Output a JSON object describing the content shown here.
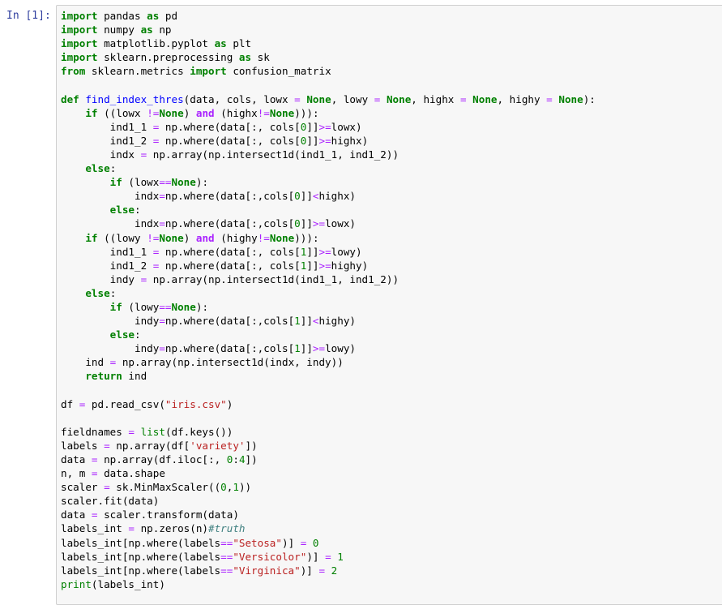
{
  "cell": {
    "prompt": "In [1]:",
    "lines": [
      [
        [
          "k",
          "import"
        ],
        [
          "t",
          " pandas "
        ],
        [
          "k",
          "as"
        ],
        [
          "t",
          " pd"
        ]
      ],
      [
        [
          "k",
          "import"
        ],
        [
          "t",
          " numpy "
        ],
        [
          "k",
          "as"
        ],
        [
          "t",
          " np"
        ]
      ],
      [
        [
          "k",
          "import"
        ],
        [
          "t",
          " matplotlib.pyplot "
        ],
        [
          "k",
          "as"
        ],
        [
          "t",
          " plt"
        ]
      ],
      [
        [
          "k",
          "import"
        ],
        [
          "t",
          " sklearn.preprocessing "
        ],
        [
          "k",
          "as"
        ],
        [
          "t",
          " sk"
        ]
      ],
      [
        [
          "k",
          "from"
        ],
        [
          "t",
          " sklearn.metrics "
        ],
        [
          "k",
          "import"
        ],
        [
          "t",
          " confusion_matrix"
        ]
      ],
      [],
      [
        [
          "k",
          "def"
        ],
        [
          "t",
          " "
        ],
        [
          "nf",
          "find_index_thres"
        ],
        [
          "t",
          "(data, cols, lowx "
        ],
        [
          "o",
          "="
        ],
        [
          "t",
          " "
        ],
        [
          "k",
          "None"
        ],
        [
          "t",
          ", lowy "
        ],
        [
          "o",
          "="
        ],
        [
          "t",
          " "
        ],
        [
          "k",
          "None"
        ],
        [
          "t",
          ", highx "
        ],
        [
          "o",
          "="
        ],
        [
          "t",
          " "
        ],
        [
          "k",
          "None"
        ],
        [
          "t",
          ", highy "
        ],
        [
          "o",
          "="
        ],
        [
          "t",
          " "
        ],
        [
          "k",
          "None"
        ],
        [
          "t",
          "):"
        ]
      ],
      [
        [
          "t",
          "    "
        ],
        [
          "k",
          "if"
        ],
        [
          "t",
          " ((lowx "
        ],
        [
          "o",
          "!="
        ],
        [
          "k",
          "None"
        ],
        [
          "t",
          ") "
        ],
        [
          "ow",
          "and"
        ],
        [
          "t",
          " (highx"
        ],
        [
          "o",
          "!="
        ],
        [
          "k",
          "None"
        ],
        [
          "t",
          "))):"
        ]
      ],
      [
        [
          "t",
          "        ind1_1 "
        ],
        [
          "o",
          "="
        ],
        [
          "t",
          " np.where(data[:, cols["
        ],
        [
          "m",
          "0"
        ],
        [
          "t",
          "]]"
        ],
        [
          "o",
          ">="
        ],
        [
          "t",
          "lowx)"
        ]
      ],
      [
        [
          "t",
          "        ind1_2 "
        ],
        [
          "o",
          "="
        ],
        [
          "t",
          " np.where(data[:, cols["
        ],
        [
          "m",
          "0"
        ],
        [
          "t",
          "]]"
        ],
        [
          "o",
          ">="
        ],
        [
          "t",
          "highx)"
        ]
      ],
      [
        [
          "t",
          "        indx "
        ],
        [
          "o",
          "="
        ],
        [
          "t",
          " np.array(np.intersect1d(ind1_1, ind1_2))"
        ]
      ],
      [
        [
          "t",
          "    "
        ],
        [
          "k",
          "else"
        ],
        [
          "t",
          ":"
        ]
      ],
      [
        [
          "t",
          "        "
        ],
        [
          "k",
          "if"
        ],
        [
          "t",
          " (lowx"
        ],
        [
          "o",
          "=="
        ],
        [
          "k",
          "None"
        ],
        [
          "t",
          "):"
        ]
      ],
      [
        [
          "t",
          "            indx"
        ],
        [
          "o",
          "="
        ],
        [
          "t",
          "np.where(data[:,cols["
        ],
        [
          "m",
          "0"
        ],
        [
          "t",
          "]]"
        ],
        [
          "o",
          "<"
        ],
        [
          "t",
          "highx)"
        ]
      ],
      [
        [
          "t",
          "        "
        ],
        [
          "k",
          "else"
        ],
        [
          "t",
          ":"
        ]
      ],
      [
        [
          "t",
          "            indx"
        ],
        [
          "o",
          "="
        ],
        [
          "t",
          "np.where(data[:,cols["
        ],
        [
          "m",
          "0"
        ],
        [
          "t",
          "]]"
        ],
        [
          "o",
          ">="
        ],
        [
          "t",
          "lowx)"
        ]
      ],
      [
        [
          "t",
          "    "
        ],
        [
          "k",
          "if"
        ],
        [
          "t",
          " ((lowy "
        ],
        [
          "o",
          "!="
        ],
        [
          "k",
          "None"
        ],
        [
          "t",
          ") "
        ],
        [
          "ow",
          "and"
        ],
        [
          "t",
          " (highy"
        ],
        [
          "o",
          "!="
        ],
        [
          "k",
          "None"
        ],
        [
          "t",
          "))):"
        ]
      ],
      [
        [
          "t",
          "        ind1_1 "
        ],
        [
          "o",
          "="
        ],
        [
          "t",
          " np.where(data[:, cols["
        ],
        [
          "m",
          "1"
        ],
        [
          "t",
          "]]"
        ],
        [
          "o",
          ">="
        ],
        [
          "t",
          "lowy)"
        ]
      ],
      [
        [
          "t",
          "        ind1_2 "
        ],
        [
          "o",
          "="
        ],
        [
          "t",
          " np.where(data[:, cols["
        ],
        [
          "m",
          "1"
        ],
        [
          "t",
          "]]"
        ],
        [
          "o",
          ">="
        ],
        [
          "t",
          "highy)"
        ]
      ],
      [
        [
          "t",
          "        indy "
        ],
        [
          "o",
          "="
        ],
        [
          "t",
          " np.array(np.intersect1d(ind1_1, ind1_2))"
        ]
      ],
      [
        [
          "t",
          "    "
        ],
        [
          "k",
          "else"
        ],
        [
          "t",
          ":"
        ]
      ],
      [
        [
          "t",
          "        "
        ],
        [
          "k",
          "if"
        ],
        [
          "t",
          " (lowy"
        ],
        [
          "o",
          "=="
        ],
        [
          "k",
          "None"
        ],
        [
          "t",
          "):"
        ]
      ],
      [
        [
          "t",
          "            indy"
        ],
        [
          "o",
          "="
        ],
        [
          "t",
          "np.where(data[:,cols["
        ],
        [
          "m",
          "1"
        ],
        [
          "t",
          "]]"
        ],
        [
          "o",
          "<"
        ],
        [
          "t",
          "highy)"
        ]
      ],
      [
        [
          "t",
          "        "
        ],
        [
          "k",
          "else"
        ],
        [
          "t",
          ":"
        ]
      ],
      [
        [
          "t",
          "            indy"
        ],
        [
          "o",
          "="
        ],
        [
          "t",
          "np.where(data[:,cols["
        ],
        [
          "m",
          "1"
        ],
        [
          "t",
          "]]"
        ],
        [
          "o",
          ">="
        ],
        [
          "t",
          "lowy)"
        ]
      ],
      [
        [
          "t",
          "    ind "
        ],
        [
          "o",
          "="
        ],
        [
          "t",
          " np.array(np.intersect1d(indx, indy))"
        ]
      ],
      [
        [
          "t",
          "    "
        ],
        [
          "k",
          "return"
        ],
        [
          "t",
          " ind"
        ]
      ],
      [],
      [
        [
          "t",
          "df "
        ],
        [
          "o",
          "="
        ],
        [
          "t",
          " pd.read_csv("
        ],
        [
          "s",
          "\"iris.csv\""
        ],
        [
          "t",
          ")"
        ]
      ],
      [],
      [
        [
          "t",
          "fieldnames "
        ],
        [
          "o",
          "="
        ],
        [
          "t",
          " "
        ],
        [
          "nb",
          "list"
        ],
        [
          "t",
          "(df.keys())"
        ]
      ],
      [
        [
          "t",
          "labels "
        ],
        [
          "o",
          "="
        ],
        [
          "t",
          " np.array(df["
        ],
        [
          "s",
          "'variety'"
        ],
        [
          "t",
          "])"
        ]
      ],
      [
        [
          "t",
          "data "
        ],
        [
          "o",
          "="
        ],
        [
          "t",
          " np.array(df.iloc[:, "
        ],
        [
          "m",
          "0"
        ],
        [
          "t",
          ":"
        ],
        [
          "m",
          "4"
        ],
        [
          "t",
          "])"
        ]
      ],
      [
        [
          "t",
          "n, m "
        ],
        [
          "o",
          "="
        ],
        [
          "t",
          " data.shape"
        ]
      ],
      [
        [
          "t",
          "scaler "
        ],
        [
          "o",
          "="
        ],
        [
          "t",
          " sk.MinMaxScaler(("
        ],
        [
          "m",
          "0"
        ],
        [
          "t",
          ","
        ],
        [
          "m",
          "1"
        ],
        [
          "t",
          "))"
        ]
      ],
      [
        [
          "t",
          "scaler.fit(data)"
        ]
      ],
      [
        [
          "t",
          "data "
        ],
        [
          "o",
          "="
        ],
        [
          "t",
          " scaler.transform(data)"
        ]
      ],
      [
        [
          "t",
          "labels_int "
        ],
        [
          "o",
          "="
        ],
        [
          "t",
          " np.zeros(n)"
        ],
        [
          "c",
          "#truth"
        ]
      ],
      [
        [
          "t",
          "labels_int[np.where(labels"
        ],
        [
          "o",
          "=="
        ],
        [
          "s",
          "\"Setosa\""
        ],
        [
          "t",
          ")] "
        ],
        [
          "o",
          "="
        ],
        [
          "t",
          " "
        ],
        [
          "m",
          "0"
        ]
      ],
      [
        [
          "t",
          "labels_int[np.where(labels"
        ],
        [
          "o",
          "=="
        ],
        [
          "s",
          "\"Versicolor\""
        ],
        [
          "t",
          ")] "
        ],
        [
          "o",
          "="
        ],
        [
          "t",
          " "
        ],
        [
          "m",
          "1"
        ]
      ],
      [
        [
          "t",
          "labels_int[np.where(labels"
        ],
        [
          "o",
          "=="
        ],
        [
          "s",
          "\"Virginica\""
        ],
        [
          "t",
          ")] "
        ],
        [
          "o",
          "="
        ],
        [
          "t",
          " "
        ],
        [
          "m",
          "2"
        ]
      ],
      [
        [
          "nb",
          "print"
        ],
        [
          "t",
          "(labels_int)"
        ]
      ]
    ]
  }
}
